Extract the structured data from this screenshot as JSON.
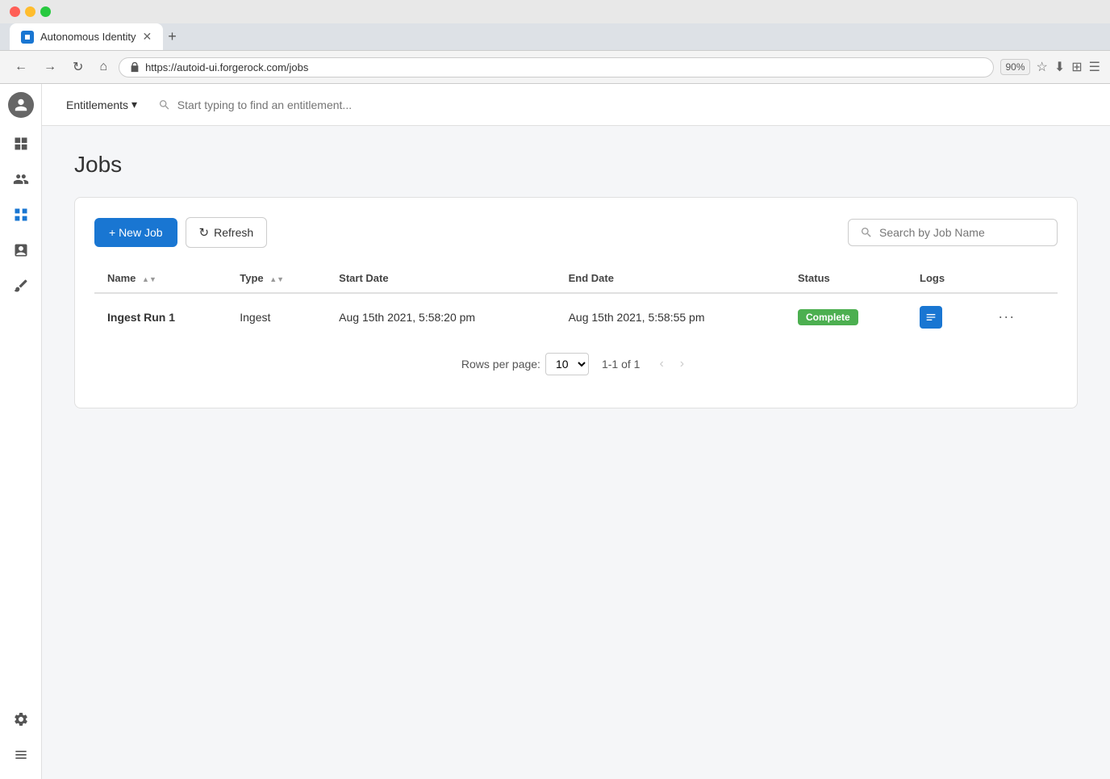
{
  "browser": {
    "tab_title": "Autonomous Identity",
    "tab_favicon": "AI",
    "url": "https://autoid-ui.forgerock.com/jobs",
    "zoom": "90%"
  },
  "nav": {
    "entitlements_label": "Entitlements",
    "search_placeholder": "Start typing to find an entitlement..."
  },
  "page": {
    "title": "Jobs",
    "toolbar": {
      "new_job_label": "+ New Job",
      "refresh_label": "Refresh",
      "search_placeholder": "Search by Job Name"
    },
    "table": {
      "columns": [
        {
          "key": "name",
          "label": "Name",
          "sortable": true
        },
        {
          "key": "type",
          "label": "Type",
          "sortable": true
        },
        {
          "key": "start_date",
          "label": "Start Date",
          "sortable": false
        },
        {
          "key": "end_date",
          "label": "End Date",
          "sortable": false
        },
        {
          "key": "status",
          "label": "Status",
          "sortable": false
        },
        {
          "key": "logs",
          "label": "Logs",
          "sortable": false
        }
      ],
      "rows": [
        {
          "name": "Ingest Run 1",
          "type": "Ingest",
          "start_date": "Aug 15th 2021, 5:58:20 pm",
          "end_date": "Aug 15th 2021, 5:58:55 pm",
          "status": "Complete",
          "status_color": "#4caf50"
        }
      ]
    },
    "pagination": {
      "rows_per_page_label": "Rows per page:",
      "rows_per_page_value": "10",
      "page_info": "1-1 of 1"
    }
  },
  "sidebar": {
    "items": [
      {
        "name": "dashboard",
        "icon": "grid"
      },
      {
        "name": "users",
        "icon": "users"
      },
      {
        "name": "apps",
        "icon": "apps"
      },
      {
        "name": "tasks",
        "icon": "tasks"
      },
      {
        "name": "brush",
        "icon": "brush"
      },
      {
        "name": "settings",
        "icon": "settings"
      }
    ]
  }
}
